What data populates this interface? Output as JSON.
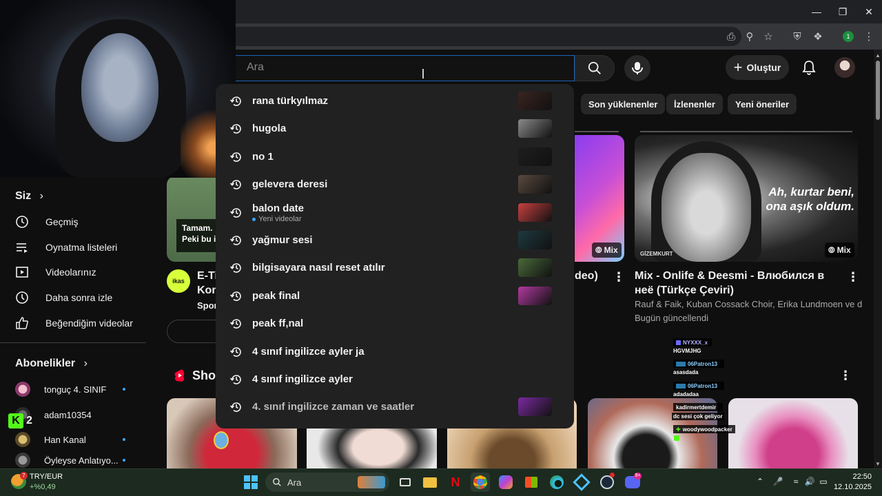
{
  "masthead": {
    "search_placeholder": "Ara",
    "create_label": "Oluştur"
  },
  "chips": [
    "Son yüklenenler",
    "İzlenenler",
    "Yeni öneriler"
  ],
  "sidebar": {
    "you_heading": "Siz",
    "items": [
      {
        "label": "Geçmiş",
        "icon": "history-icon"
      },
      {
        "label": "Oynatma listeleri",
        "icon": "playlist-icon"
      },
      {
        "label": "Videolarınız",
        "icon": "your-videos-icon"
      },
      {
        "label": "Daha sonra izle",
        "icon": "watch-later-icon"
      },
      {
        "label": "Beğendiğim videolar",
        "icon": "like-icon"
      }
    ],
    "subscriptions_heading": "Abonelikler",
    "subscriptions": [
      {
        "name": "tonguç 4. SINIF",
        "new": true
      },
      {
        "name": "adam10354",
        "new": false
      },
      {
        "name": "Han Kanal",
        "new": true
      },
      {
        "name": "Öyleyse Anlatıyo...",
        "new": true
      }
    ]
  },
  "suggestions": [
    {
      "text": "rana türkyılmaz",
      "thumb": "#3a2420"
    },
    {
      "text": "hugola",
      "thumb": "#8a8a8a"
    },
    {
      "text": "no 1",
      "thumb": "#1e1e1e"
    },
    {
      "text": "gelevera deresi",
      "thumb": "#5a4a40"
    },
    {
      "text": "balon date",
      "sub": "Yeni videolar",
      "thumb": "#c84040"
    },
    {
      "text": "yağmur sesi",
      "thumb": "#1e3a40"
    },
    {
      "text": "bilgisayara nasıl reset atılır",
      "thumb": "#4a6a3a"
    },
    {
      "text": "peak final",
      "thumb": "#b23aa0"
    },
    {
      "text": "peak ff,nal",
      "thumb": ""
    },
    {
      "text": "4 sınıf ingilizce ayler ja",
      "thumb": ""
    },
    {
      "text": "4 sınıf ingilizce ayler",
      "thumb": ""
    },
    {
      "text": "4. sınıf ingilizce zaman ve saatler",
      "thumb": "#7a2aa0"
    }
  ],
  "videos": {
    "left": {
      "title_fragment": "E-Ti",
      "title_fragment2": "Kom",
      "channel_fragment": "Spor",
      "thumb_caption": "Tamam. \nPeki bu is",
      "logo_text": "ikas"
    },
    "middle": {
      "title_fragment": "deo)",
      "badge": "Mix"
    },
    "right": {
      "title": "Mix - Onlife & Deesmi - Влюбился в неё (Türkçe Çeviri)",
      "channels": "Rauf & Faik, Kuban Cossack Choir, Erika Lundmoen ve d...",
      "updated": "Bugün güncellendi",
      "badge": "Mix",
      "thumb_quote": "Ah, kurtar beni, ona aşık oldum.",
      "thumb_credit": "GİZEMKURT"
    }
  },
  "shorts_label": "Shor",
  "chat": [
    {
      "user": "NYXXX_x",
      "msg": "HGVMJHG",
      "color": "#2b2b8a"
    },
    {
      "user": "06Patron13",
      "msg": "asasdada",
      "color": "#1f4a6a"
    },
    {
      "user": "06Patron13",
      "msg": "adadadaa",
      "color": "#1f4a6a"
    },
    {
      "user": "kadirmertdemir",
      "msg": "dc sesi çok geliyor",
      "color": "#333"
    },
    {
      "user": "woodywoodpacker",
      "msg": "",
      "color": "#333"
    }
  ],
  "taskbar": {
    "weather_name": "TRY/EUR",
    "weather_value": "+%0,49",
    "search_label": "Ara",
    "time": "22:50",
    "date": "12.10.2025",
    "kick_count": "2",
    "notif_badge": "7"
  },
  "colors": {
    "accent_blue": "#3ea6ff",
    "youtube_red": "#ff0033",
    "search_border": "#1c62b9"
  }
}
